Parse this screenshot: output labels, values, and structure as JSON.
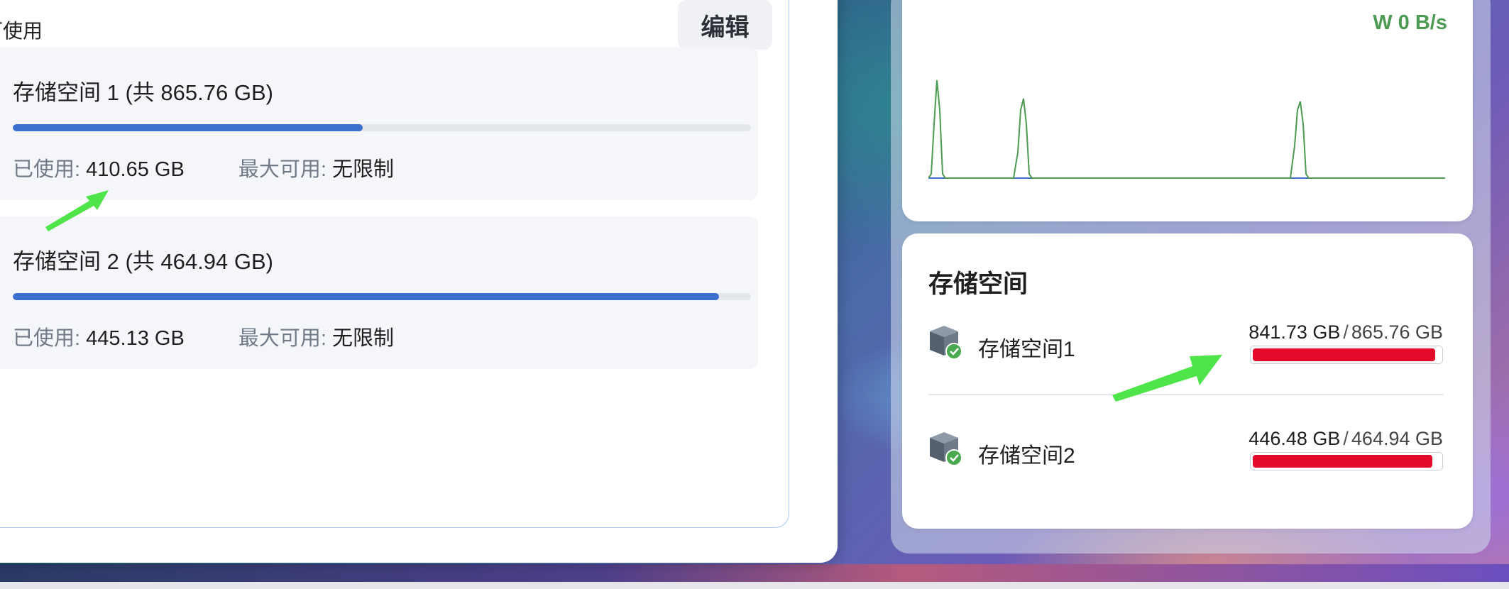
{
  "left_panel": {
    "available_label": "可使用",
    "edit_button": "编辑",
    "pools": [
      {
        "title": "存储空间 1 (共 865.76 GB)",
        "used_label": "已使用:",
        "used_value": "410.65 GB",
        "max_label": "最大可用:",
        "max_value": "无限制",
        "usage_fraction": 0.474
      },
      {
        "title": "存储空间 2 (共 464.94 GB)",
        "used_label": "已使用:",
        "used_value": "445.13 GB",
        "max_label": "最大可用:",
        "max_value": "无限制",
        "usage_fraction": 0.957
      }
    ]
  },
  "io_widget": {
    "write_speed": "W 0 B/s",
    "line_color": "#4d9a52",
    "baseline_color": "#3a6fd0"
  },
  "storage_widget": {
    "title": "存储空间",
    "items": [
      {
        "name": "存储空间1",
        "used": "841.73 GB",
        "separator": "/",
        "total": "865.76 GB",
        "fraction": 0.972,
        "status": "ok"
      },
      {
        "name": "存储空间2",
        "used": "446.48 GB",
        "separator": "/",
        "total": "464.94 GB",
        "fraction": 0.96,
        "status": "ok"
      }
    ],
    "bar_color": "#e30a2a",
    "check_color": "#4aa84f"
  },
  "annotation_color": "#4ee44a"
}
